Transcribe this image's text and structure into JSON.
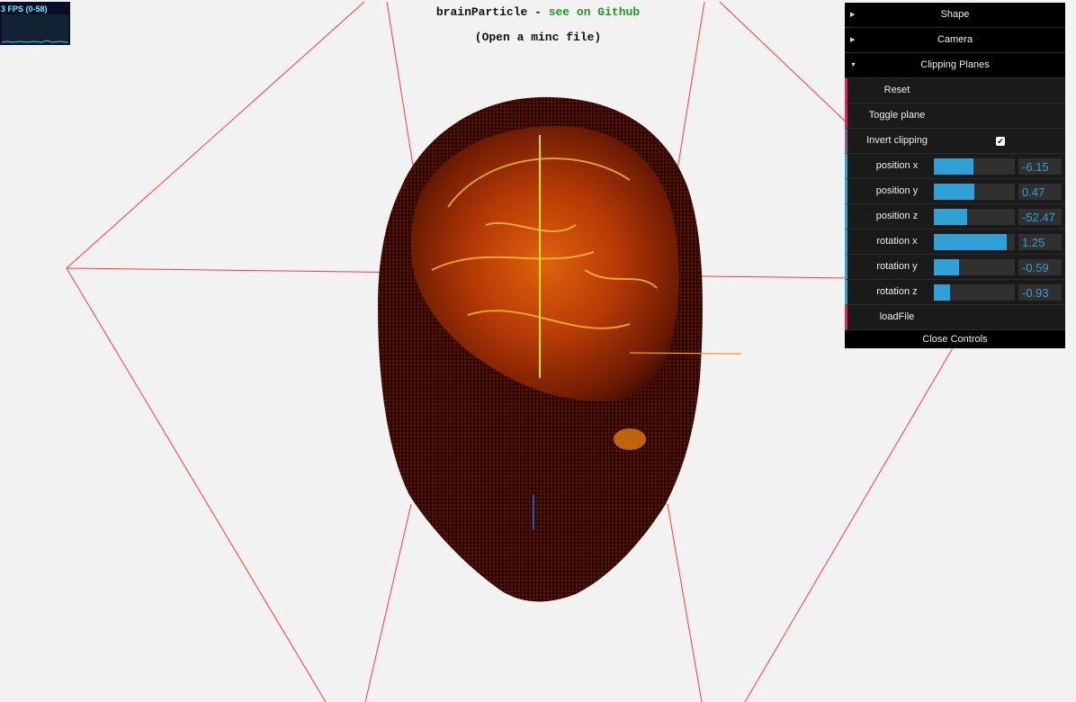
{
  "stats": {
    "fps_label": "3 FPS (0-58)"
  },
  "header": {
    "title": "brainParticle - ",
    "github_link": "see on Github",
    "subtitle": "(Open a minc file)"
  },
  "gui": {
    "folders": {
      "shape": "Shape",
      "camera": "Camera",
      "clipping": "Clipping Planes"
    },
    "reset_label": "Reset",
    "toggle_label": "Toggle plane",
    "invert_label": "Invert clipping",
    "invert_checked": true,
    "controls": [
      {
        "name": "position x",
        "value": "-6.15",
        "fill": 0.49
      },
      {
        "name": "position y",
        "value": "0.47",
        "fill": 0.5
      },
      {
        "name": "position z",
        "value": "-52.47",
        "fill": 0.41
      },
      {
        "name": "rotation x",
        "value": "1.25",
        "fill": 0.9
      },
      {
        "name": "rotation y",
        "value": "-0.59",
        "fill": 0.31
      },
      {
        "name": "rotation z",
        "value": "-0.93",
        "fill": 0.2
      }
    ],
    "load_label": "loadFile",
    "close_label": "Close Controls"
  },
  "colors": {
    "background": "#f2f2f2",
    "wireframe": "#ff0000",
    "slider_accent": "#2fa1d6",
    "function_accent": "#e61d5f",
    "link": "#1e9a1e"
  }
}
